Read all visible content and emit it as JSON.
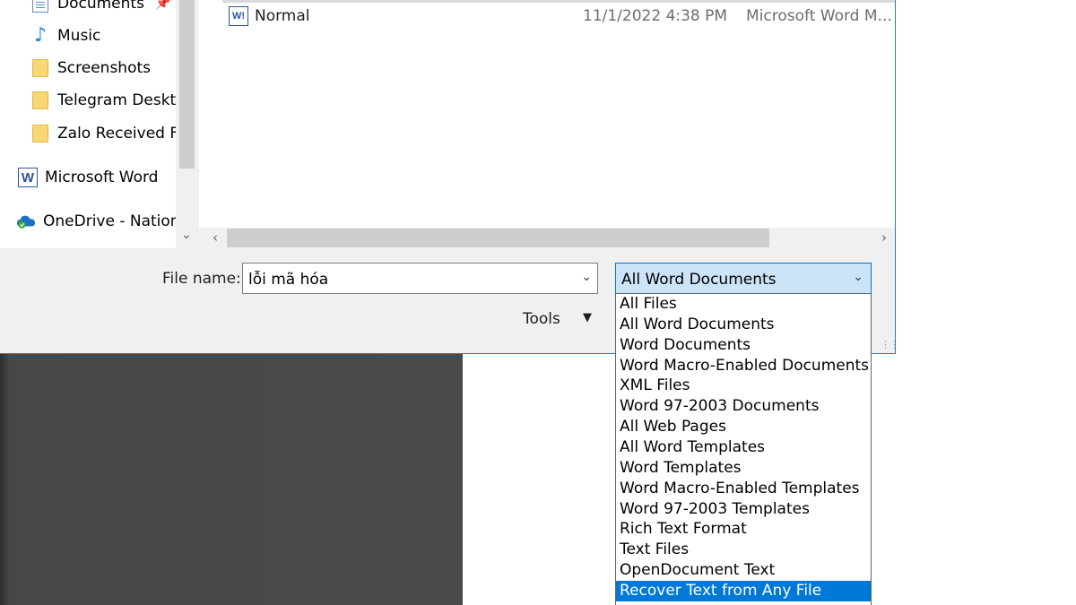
{
  "nav": {
    "items": [
      {
        "label": "Documents",
        "icon": "documents-icon",
        "pinned": true
      },
      {
        "label": "Music",
        "icon": "music-icon"
      },
      {
        "label": "Screenshots",
        "icon": "folder-icon"
      },
      {
        "label": "Telegram Deskto",
        "icon": "folder-icon"
      },
      {
        "label": "Zalo Received Fi",
        "icon": "folder-icon"
      },
      {
        "label": "Microsoft Word",
        "icon": "word-icon"
      },
      {
        "label": "OneDrive - Nation",
        "icon": "onedrive-icon"
      }
    ]
  },
  "files": [
    {
      "name": "Normal",
      "date": "11/1/2022 4:38 PM",
      "type": "Microsoft Word M..."
    }
  ],
  "filename": {
    "label": "File name:",
    "value": "lỗi mã hóa"
  },
  "filter": {
    "selected": "All Word Documents",
    "options": [
      "All Files",
      "All Word Documents",
      "Word Documents",
      "Word Macro-Enabled Documents",
      "XML Files",
      "Word 97-2003 Documents",
      "All Web Pages",
      "All Word Templates",
      "Word Templates",
      "Word Macro-Enabled Templates",
      "Word 97-2003 Templates",
      "Rich Text Format",
      "Text Files",
      "OpenDocument Text",
      "Recover Text from Any File"
    ],
    "highlighted_index": 14
  },
  "tools": {
    "label": "Tools"
  },
  "colors": {
    "accent": "#0078d7",
    "dialog_bg": "#f0f0f0",
    "dark_area": "#474747"
  }
}
